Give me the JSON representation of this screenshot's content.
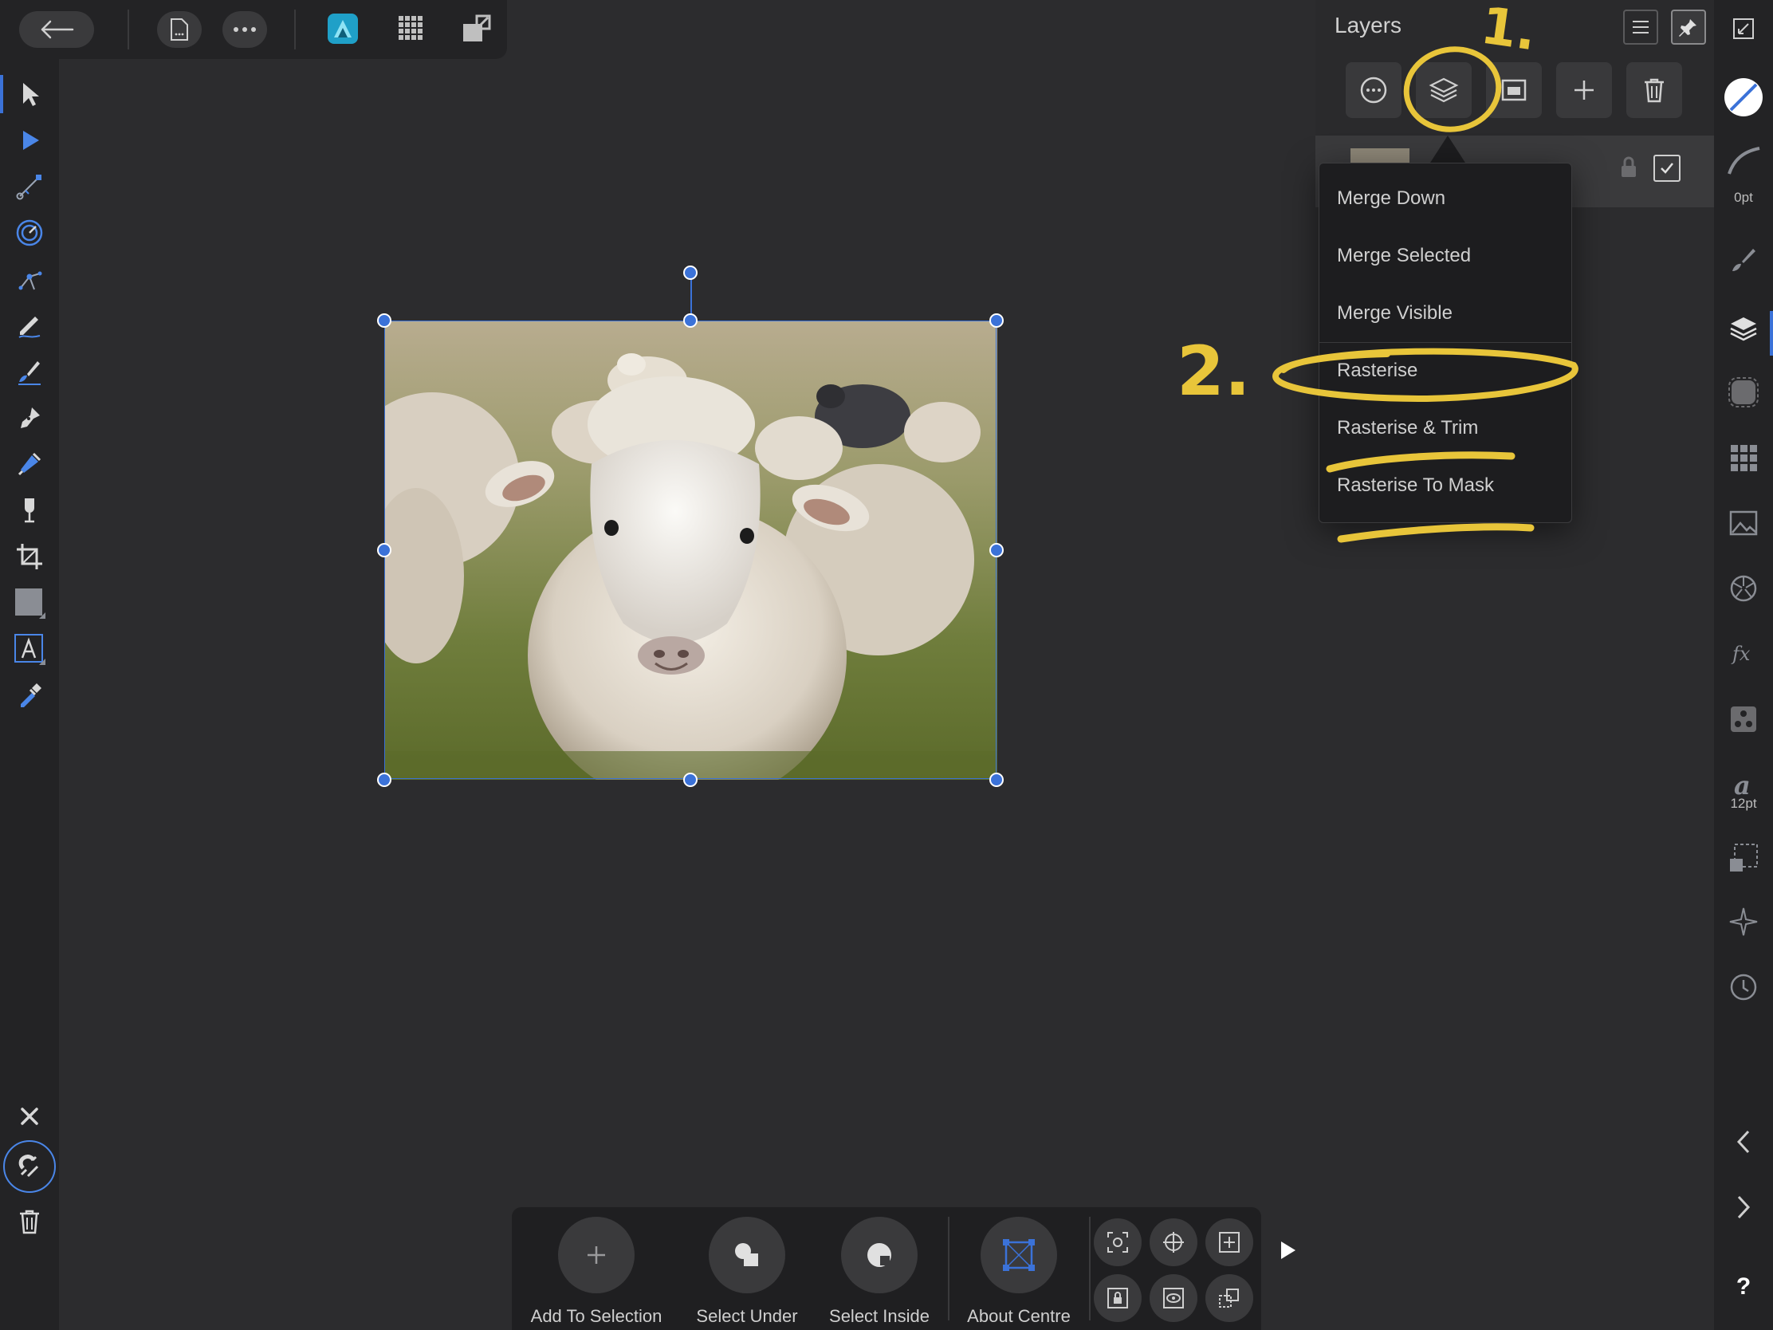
{
  "layers_panel": {
    "title": "Layers"
  },
  "layer_menu": {
    "items": [
      "Merge Down",
      "Merge Selected",
      "Merge Visible",
      "Rasterise",
      "Rasterise & Trim",
      "Rasterise To Mask"
    ]
  },
  "studio": {
    "stroke_width": "0pt",
    "font_size": "12pt",
    "help_label": "?"
  },
  "context_toolbar": {
    "add_to_selection": "Add To Selection",
    "select_under": "Select Under",
    "select_inside": "Select Inside",
    "about_centre": "About Centre"
  },
  "annotations": {
    "step1": "1.",
    "step2": "2."
  },
  "colors": {
    "accent": "#3b72d8",
    "annotation": "#e8c53a",
    "background": "#2c2c2e"
  }
}
